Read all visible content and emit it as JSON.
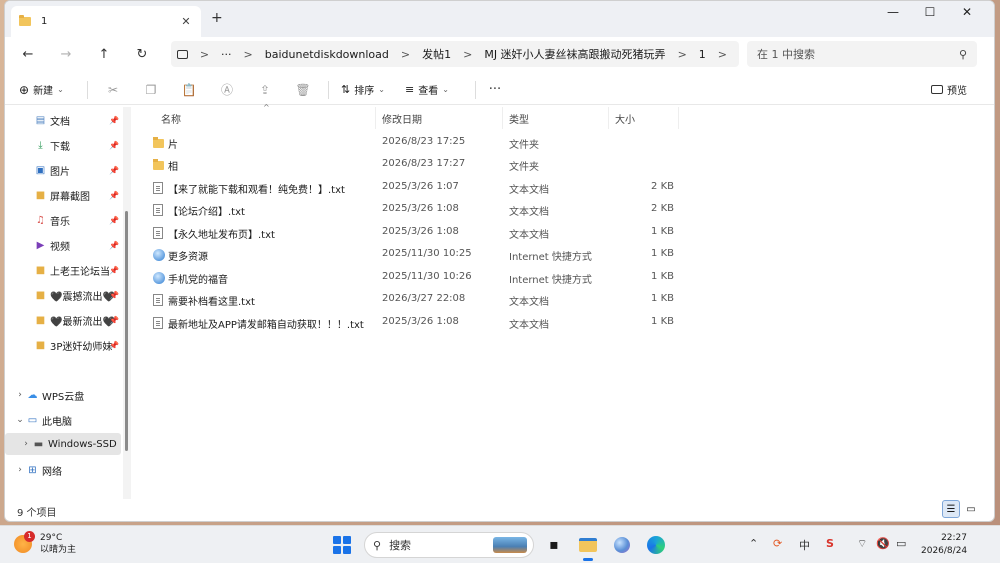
{
  "window": {
    "tab_title": "1",
    "new_tab": "+",
    "controls": {
      "minimize": "—",
      "maximize": "☐",
      "close": "✕"
    }
  },
  "nav": {
    "back": "←",
    "forward": "→",
    "up": "↑",
    "refresh": "↻",
    "more": "···",
    "breadcrumb": [
      "baidunetdiskdownload",
      "发帖1",
      "MJ 迷奸小人妻丝袜高跟搬动死猪玩弄",
      "1"
    ],
    "search_placeholder": "在 1 中搜索"
  },
  "toolbar": {
    "new_label": "新建",
    "sort_label": "排序",
    "view_label": "查看",
    "more": "···",
    "preview_label": "预览"
  },
  "sidebar": {
    "quick": [
      {
        "label": "文档",
        "icon": "document-icon",
        "pinned": true
      },
      {
        "label": "下载",
        "icon": "download-icon",
        "pinned": true
      },
      {
        "label": "图片",
        "icon": "pictures-icon",
        "pinned": true
      },
      {
        "label": "屏幕截图",
        "icon": "folder-icon",
        "pinned": true
      },
      {
        "label": "音乐",
        "icon": "music-icon",
        "pinned": true
      },
      {
        "label": "视频",
        "icon": "video-icon",
        "pinned": true
      },
      {
        "label": "上老王论坛当",
        "icon": "folder-icon",
        "pinned": true
      },
      {
        "label": "🖤震撼流出🖤",
        "icon": "folder-icon",
        "pinned": true
      },
      {
        "label": "🖤最新流出🖤",
        "icon": "folder-icon",
        "pinned": true
      },
      {
        "label": "3P迷奸幼师妹",
        "icon": "folder-icon",
        "pinned": true
      }
    ],
    "tree": [
      {
        "label": "WPS云盘",
        "icon": "cloud-icon"
      },
      {
        "label": "此电脑",
        "icon": "computer-icon"
      },
      {
        "label": "Windows-SSD",
        "icon": "drive-icon"
      },
      {
        "label": "网络",
        "icon": "network-icon"
      }
    ]
  },
  "columns": {
    "name": "名称",
    "date": "修改日期",
    "type": "类型",
    "size": "大小"
  },
  "files": [
    {
      "name": "片",
      "date": "2026/8/23 17:25",
      "type": "文件夹",
      "size": "",
      "icon": "folder"
    },
    {
      "name": "相",
      "date": "2026/8/23 17:27",
      "type": "文件夹",
      "size": "",
      "icon": "folder"
    },
    {
      "name": "【来了就能下载和观看！纯免费！】.txt",
      "date": "2025/3/26 1:07",
      "type": "文本文档",
      "size": "2 KB",
      "icon": "txt"
    },
    {
      "name": "【论坛介绍】.txt",
      "date": "2025/3/26 1:08",
      "type": "文本文档",
      "size": "2 KB",
      "icon": "txt"
    },
    {
      "name": "【永久地址发布页】.txt",
      "date": "2025/3/26 1:08",
      "type": "文本文档",
      "size": "1 KB",
      "icon": "txt"
    },
    {
      "name": "更多资源",
      "date": "2025/11/30 10:25",
      "type": "Internet 快捷方式",
      "size": "1 KB",
      "icon": "url"
    },
    {
      "name": "手机党的福音",
      "date": "2025/11/30 10:26",
      "type": "Internet 快捷方式",
      "size": "1 KB",
      "icon": "url"
    },
    {
      "name": "需要补档看这里.txt",
      "date": "2026/3/27 22:08",
      "type": "文本文档",
      "size": "1 KB",
      "icon": "txt"
    },
    {
      "name": "最新地址及APP请发邮箱自动获取！！！.txt",
      "date": "2025/3/26 1:08",
      "type": "文本文档",
      "size": "1 KB",
      "icon": "txt"
    }
  ],
  "status": {
    "item_count": "9 个项目"
  },
  "taskbar": {
    "weather_temp": "29°C",
    "weather_desc": "以晴为主",
    "weather_badge": "1",
    "search_label": "搜索",
    "ime": "中",
    "time": "22:27",
    "date": "2026/8/24"
  }
}
